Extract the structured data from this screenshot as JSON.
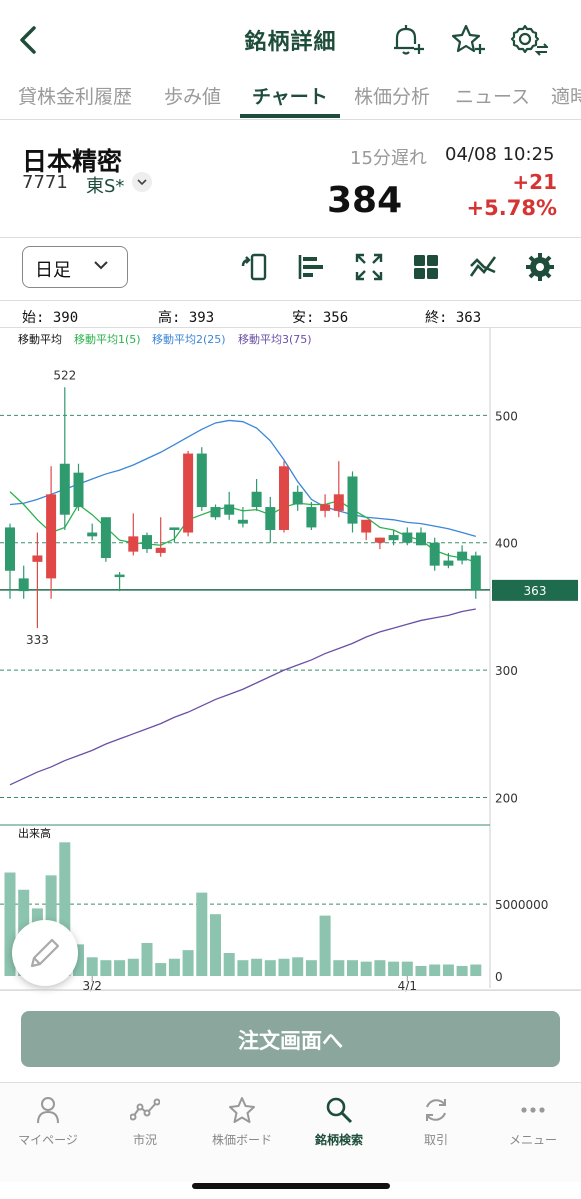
{
  "header": {
    "title": "銘柄詳細"
  },
  "tabs": [
    {
      "label": "貸株金利履歴"
    },
    {
      "label": "歩み値"
    },
    {
      "label": "チャート",
      "active": true
    },
    {
      "label": "株価分析"
    },
    {
      "label": "ニュース"
    },
    {
      "label": "適時"
    }
  ],
  "stock": {
    "name": "日本精密",
    "code": "7771",
    "market": "東S*",
    "delay": "15分遅れ",
    "datetime": "04/08 10:25",
    "price": "384",
    "change": "+21",
    "change_pct": "+5.78%",
    "change_color": "#d63333"
  },
  "toolbar": {
    "period": "日足",
    "icons": [
      "rotate-phone-icon",
      "bar-align-icon",
      "expand-icon",
      "grid-icon",
      "line-chart-icon",
      "gear-icon"
    ]
  },
  "ohlc": {
    "open": "始: 390",
    "high": "高: 393",
    "low": "安: 356",
    "close": "終: 363"
  },
  "chart_data": {
    "type": "candlestick",
    "ma_labels": {
      "title": "移動平均",
      "ma1": "移動平均1(5)",
      "ma2": "移動平均2(25)",
      "ma3": "移動平均3(75)"
    },
    "colors": {
      "up": "#e04848",
      "down": "#2e9a6e",
      "ma1": "#2bb24c",
      "ma2": "#3a86d9",
      "ma3": "#6b4fa6",
      "grid": "#3a8f6a"
    },
    "price_ylim": [
      180,
      545
    ],
    "yticks": [
      200,
      300,
      400,
      500
    ],
    "high_label": "522",
    "low_label": "333",
    "last_label": "363",
    "last_value": 363,
    "x_labels": [
      {
        "index": 6,
        "label": "3/2"
      },
      {
        "index": 29,
        "label": "4/1"
      }
    ],
    "candles": [
      {
        "o": 412,
        "h": 415,
        "l": 356,
        "c": 378
      },
      {
        "o": 372,
        "h": 382,
        "l": 356,
        "c": 362
      },
      {
        "o": 385,
        "h": 408,
        "l": 333,
        "c": 390
      },
      {
        "o": 372,
        "h": 460,
        "l": 356,
        "c": 438
      },
      {
        "o": 462,
        "h": 522,
        "l": 410,
        "c": 422
      },
      {
        "o": 455,
        "h": 462,
        "l": 425,
        "c": 428
      },
      {
        "o": 408,
        "h": 415,
        "l": 402,
        "c": 405
      },
      {
        "o": 420,
        "h": 420,
        "l": 385,
        "c": 388
      },
      {
        "o": 375,
        "h": 377,
        "l": 362,
        "c": 373
      },
      {
        "o": 393,
        "h": 423,
        "l": 390,
        "c": 405
      },
      {
        "o": 406,
        "h": 408,
        "l": 392,
        "c": 395
      },
      {
        "o": 392,
        "h": 420,
        "l": 389,
        "c": 396
      },
      {
        "o": 412,
        "h": 412,
        "l": 400,
        "c": 410
      },
      {
        "o": 408,
        "h": 472,
        "l": 405,
        "c": 470
      },
      {
        "o": 470,
        "h": 475,
        "l": 425,
        "c": 428
      },
      {
        "o": 428,
        "h": 430,
        "l": 418,
        "c": 420
      },
      {
        "o": 430,
        "h": 440,
        "l": 418,
        "c": 422
      },
      {
        "o": 418,
        "h": 428,
        "l": 412,
        "c": 415
      },
      {
        "o": 440,
        "h": 450,
        "l": 425,
        "c": 428
      },
      {
        "o": 428,
        "h": 436,
        "l": 400,
        "c": 410
      },
      {
        "o": 410,
        "h": 464,
        "l": 408,
        "c": 460
      },
      {
        "o": 440,
        "h": 445,
        "l": 425,
        "c": 430
      },
      {
        "o": 428,
        "h": 432,
        "l": 410,
        "c": 412
      },
      {
        "o": 425,
        "h": 438,
        "l": 420,
        "c": 430
      },
      {
        "o": 425,
        "h": 464,
        "l": 420,
        "c": 438
      },
      {
        "o": 452,
        "h": 456,
        "l": 408,
        "c": 415
      },
      {
        "o": 408,
        "h": 418,
        "l": 402,
        "c": 418
      },
      {
        "o": 400,
        "h": 404,
        "l": 395,
        "c": 404
      },
      {
        "o": 406,
        "h": 410,
        "l": 398,
        "c": 402
      },
      {
        "o": 408,
        "h": 412,
        "l": 398,
        "c": 400
      },
      {
        "o": 408,
        "h": 412,
        "l": 398,
        "c": 398
      },
      {
        "o": 400,
        "h": 404,
        "l": 378,
        "c": 382
      },
      {
        "o": 386,
        "h": 392,
        "l": 380,
        "c": 382
      },
      {
        "o": 393,
        "h": 398,
        "l": 383,
        "c": 386
      },
      {
        "o": 390,
        "h": 393,
        "l": 356,
        "c": 363
      }
    ],
    "ma1": [
      440,
      430,
      418,
      408,
      412,
      430,
      422,
      412,
      402,
      400,
      399,
      398,
      403,
      418,
      422,
      426,
      428,
      425,
      426,
      422,
      428,
      431,
      430,
      430,
      433,
      426,
      420,
      412,
      410,
      405,
      402,
      394,
      390,
      388,
      385
    ],
    "ma2": [
      430,
      431,
      434,
      438,
      442,
      446,
      450,
      454,
      457,
      461,
      466,
      471,
      477,
      483,
      489,
      494,
      496,
      495,
      490,
      480,
      465,
      448,
      434,
      428,
      425,
      422,
      420,
      419,
      418,
      416,
      415,
      413,
      411,
      408,
      405
    ],
    "ma3": [
      210,
      215,
      220,
      224,
      229,
      233,
      237,
      242,
      246,
      250,
      254,
      258,
      263,
      267,
      272,
      277,
      281,
      285,
      290,
      295,
      300,
      304,
      308,
      313,
      317,
      321,
      326,
      330,
      333,
      336,
      339,
      341,
      343,
      346,
      348
    ],
    "volume_label": "出来高",
    "volume_tick": "5000000",
    "volume_zero": "0",
    "volume_ylim": [
      0,
      9600000
    ],
    "volume": [
      7200000,
      6000000,
      4700000,
      7000000,
      9300000,
      2200000,
      1300000,
      1100000,
      1100000,
      1200000,
      2300000,
      900000,
      1200000,
      1800000,
      5800000,
      4300000,
      1600000,
      1100000,
      1200000,
      1100000,
      1200000,
      1300000,
      1100000,
      4200000,
      1100000,
      1100000,
      1000000,
      1100000,
      1000000,
      1000000,
      700000,
      800000,
      800000,
      700000,
      800000
    ],
    "volume_color": "#8cc4b0",
    "grid": true
  },
  "order": {
    "label": "注文画面へ"
  },
  "bottom_nav": [
    {
      "label": "マイページ",
      "icon": "person-icon"
    },
    {
      "label": "市況",
      "icon": "market-icon"
    },
    {
      "label": "株価ボード",
      "icon": "star-icon"
    },
    {
      "label": "銘柄検索",
      "icon": "search-icon",
      "active": true
    },
    {
      "label": "取引",
      "icon": "trade-icon"
    },
    {
      "label": "メニュー",
      "icon": "more-icon"
    }
  ]
}
